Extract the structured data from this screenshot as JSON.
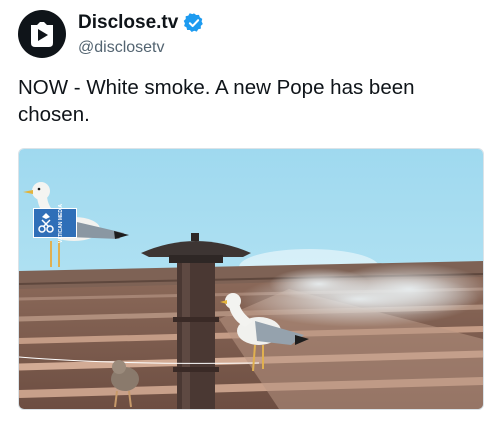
{
  "tweet": {
    "display_name": "Disclose.tv",
    "handle": "@disclosetv",
    "verified": true,
    "avatar_icon": "play-triangle-logo",
    "text": "NOW - White smoke. A new Pope has been chosen."
  },
  "media": {
    "type": "video-still",
    "badge": {
      "icon": "vatican-media-logo",
      "text": "VATICAN MEDIA"
    }
  },
  "colors": {
    "verified_badge": "#1d9bf0",
    "handle": "#536471",
    "sky": "#a9dff0",
    "badge_blue": "#2f6fb8"
  }
}
